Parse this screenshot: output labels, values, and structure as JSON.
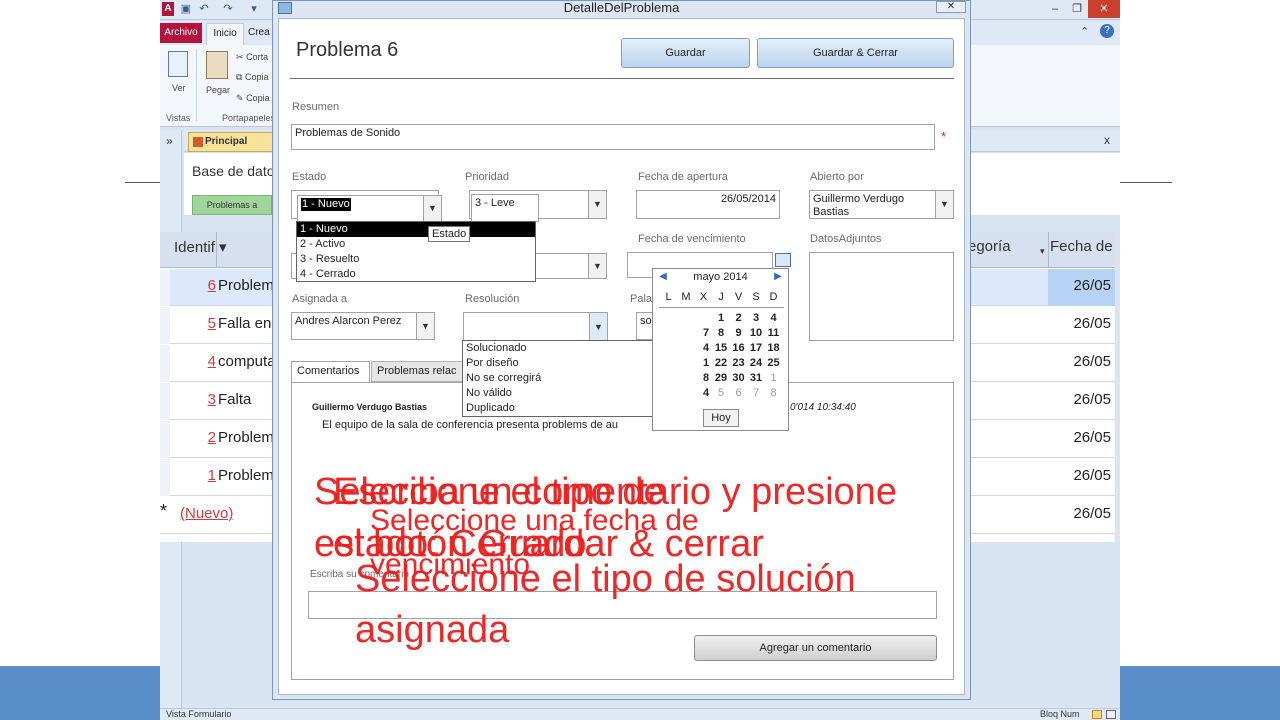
{
  "access": {
    "qa": {
      "logo": "A",
      "undo": "↶",
      "redo": "↷"
    },
    "tabs": {
      "archivo": "Archivo",
      "inicio": "Inicio",
      "crea": "Crea"
    },
    "ribbon": {
      "ver": "Ver",
      "pegar": "Pegar",
      "cortar": "Corta",
      "copiar": "Copia",
      "copiar_formato": "Copia",
      "group_vistas": "Vistas",
      "group_portapapeles": "Portapapeles"
    },
    "window_controls": {
      "minimize": "–",
      "restore": "❐",
      "close": "✕"
    },
    "doc_tab": "Principal",
    "doc_close": "x",
    "nav_toggle": "»",
    "form_title": "Base de datos",
    "form_button": "Problemas a",
    "grid": {
      "headers": {
        "id": "Identif ▾",
        "category": "egoría",
        "date": "Fecha de apert"
      },
      "rows": [
        {
          "id": "6",
          "desc": "Problemas d",
          "date": "26/05",
          "selected": true
        },
        {
          "id": "5",
          "desc": "Falla en el s",
          "date": "26/05",
          "selected": false
        },
        {
          "id": "4",
          "desc": "computador",
          "date": "26/05",
          "selected": false
        },
        {
          "id": "3",
          "desc": "Falta",
          "date": "26/05",
          "selected": false
        },
        {
          "id": "2",
          "desc": "Problemas d",
          "date": "26/05",
          "selected": false
        },
        {
          "id": "1",
          "desc": "Problemas d",
          "date": "26/05",
          "selected": false
        }
      ],
      "new_row": {
        "marker": "*",
        "label": "(Nuevo)",
        "date": "26/05"
      }
    },
    "statusbar": {
      "left": "Vista Formulario",
      "right": "Bloq Num"
    }
  },
  "dialog": {
    "title": "DetalleDelProblema",
    "close": "✕",
    "problem_title": "Problema 6",
    "buttons": {
      "save": "Guardar",
      "save_close": "Guardar & Cerrar"
    },
    "labels": {
      "resumen": "Resumen",
      "estado": "Estado",
      "prioridad": "Prioridad",
      "fecha_apertura": "Fecha de apertura",
      "abierto_por": "Abierto por",
      "fecha_vencimiento": "Fecha de vencimiento",
      "datos_adjuntos": "DatosAdjuntos",
      "asignada_a": "Asignada a",
      "resolucion": "Resolución",
      "palabras": "Pala"
    },
    "values": {
      "resumen": "Problemas de Sonido",
      "required_marker": "*",
      "estado": "1 - Nuevo",
      "prioridad": "3 - Leve",
      "fecha_apertura": "26/05/2014",
      "abierto_por": "Guillermo Verdugo Bastias",
      "asignada_a": "Andres Alarcon Perez",
      "palabras": "soporte Tecn"
    },
    "estado_options": [
      "1 - Nuevo",
      "2 - Activo",
      "3 - Resuelto",
      "4 - Cerrado"
    ],
    "estado_tooltip": "Estado",
    "resolucion_options": [
      "Solucionado",
      "Por diseño",
      "No se corregirá",
      "No válido",
      "Duplicado"
    ],
    "calendar": {
      "month": "mayo 2014",
      "prev": "◀",
      "next": "▶",
      "dow": [
        "L",
        "M",
        "X",
        "J",
        "V",
        "S",
        "D"
      ],
      "rows": [
        [
          "",
          "",
          "",
          "1",
          "2",
          "3",
          "4"
        ],
        [
          "",
          "",
          "",
          "8",
          "9",
          "10",
          "11"
        ],
        [
          "",
          "",
          "",
          "15",
          "16",
          "17",
          "18"
        ],
        [
          "",
          "",
          "",
          "22",
          "23",
          "24",
          "25"
        ],
        [
          "",
          "",
          "",
          "29",
          "30",
          "31",
          "1"
        ],
        [
          "",
          "",
          "",
          "5",
          "6",
          "7",
          "8"
        ]
      ],
      "left_digits": [
        "7",
        "4",
        "1",
        "8",
        "4"
      ],
      "today": "Hoy"
    },
    "tabs": {
      "comentarios": "Comentarios",
      "relacionados": "Problemas relac"
    },
    "comment": {
      "author": "Guillermo Verdugo Bastias",
      "timestamp": "0'014 10:34:40",
      "text": "El equipo de la sala de conferencia presenta problems de au"
    },
    "comment_input_label": "Escriba su comentario",
    "add_comment": "Agregar un comentario"
  },
  "overlays": {
    "line1": "Seleccione el tipo de",
    "line2": "estado: Cerrado",
    "line3": "Escriba un comentario  y presione",
    "line4": "el botón Guardar & cerrar",
    "line5": "Seleccione una fecha de",
    "line6": "vencimiento",
    "line7": "Seleccione el tipo de solución",
    "line8": "asignada"
  },
  "colors": {
    "overlay": "#ee1c1c",
    "slide_bar": "#5b8fc9",
    "access_red": "#b3123b"
  }
}
